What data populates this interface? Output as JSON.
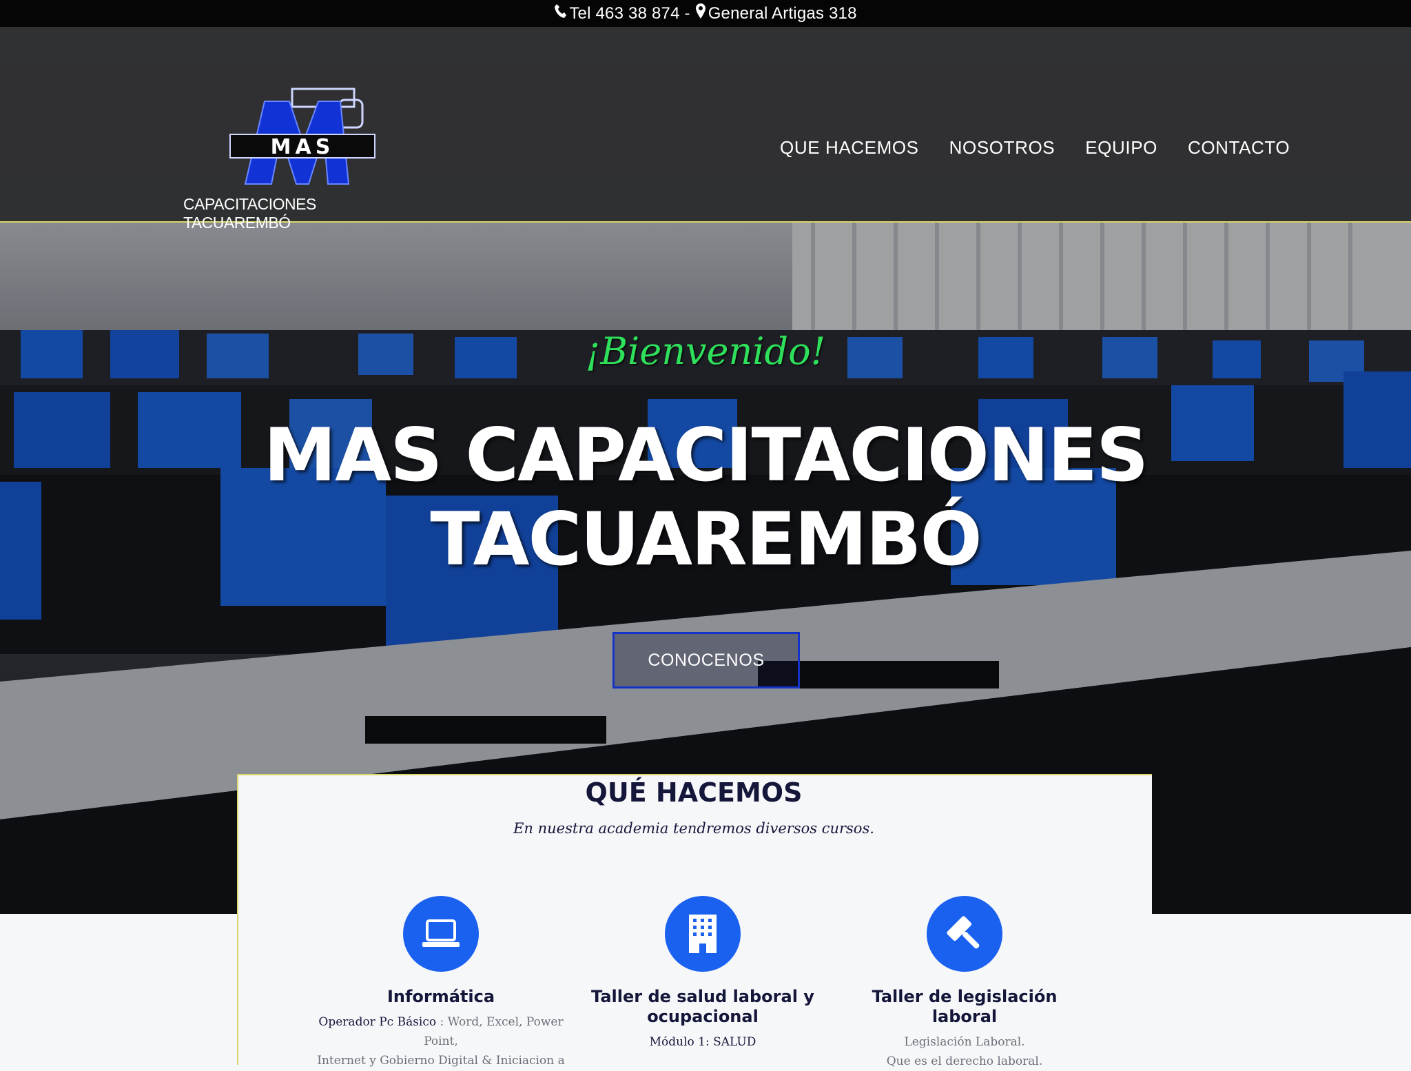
{
  "topbar": {
    "phone_icon": "phone-icon",
    "phone_text": "Tel 463 38 874 -",
    "location_icon": "map-marker-icon",
    "address_text": "General Artigas 318"
  },
  "header": {
    "logo_letters": "MAS",
    "logo_caption": "CAPACITACIONES TACUAREMBÓ",
    "nav": [
      {
        "label": "QUE HACEMOS"
      },
      {
        "label": "NOSOTROS"
      },
      {
        "label": "EQUIPO"
      },
      {
        "label": "CONTACTO"
      }
    ]
  },
  "hero": {
    "welcome": "¡Bienvenido!",
    "headline_line1": "MAS CAPACITACIONES",
    "headline_line2": "TACUAREMBÓ",
    "cta_label": "CONOCENOS"
  },
  "section": {
    "title": "QUÉ HACEMOS",
    "subtitle": "En nuestra academia tendremos diversos cursos.",
    "cards": [
      {
        "icon": "laptop-icon",
        "title": "Informática",
        "line1_strong": "Operador Pc Básico",
        "line1_rest": " : Word, Excel, Power Point,",
        "line2": "Internet y Gobierno Digital & Iniciacion a"
      },
      {
        "icon": "building-icon",
        "title": "Taller de salud laboral y ocupacional",
        "line1": "Módulo 1: SALUD"
      },
      {
        "icon": "gavel-icon",
        "title": "Taller de legislación laboral",
        "line1": "Legislación Laboral.",
        "line2": "Que es el derecho laboral."
      }
    ]
  },
  "colors": {
    "accent_blue": "#1a61f0",
    "welcome_green": "#2ee05a",
    "cta_border": "#1633c8",
    "heading_navy": "#14163a"
  }
}
